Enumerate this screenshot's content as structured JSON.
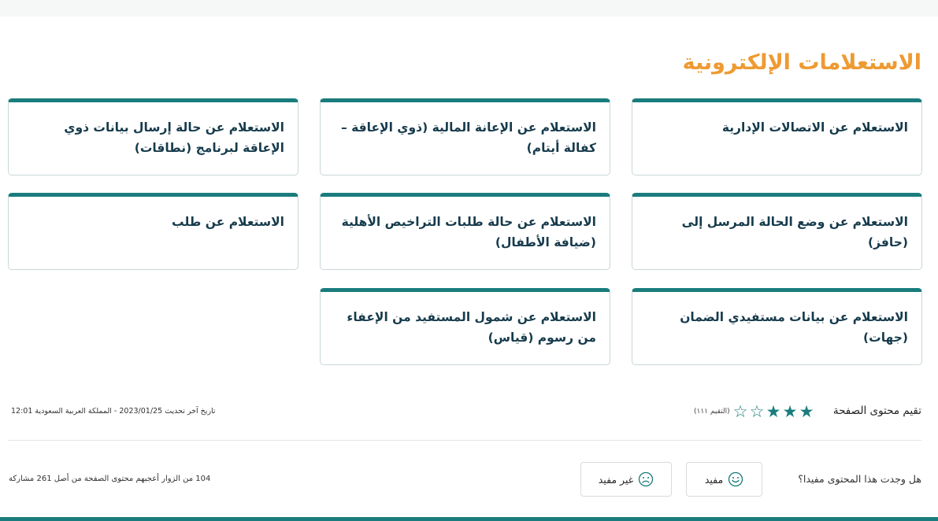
{
  "section": {
    "title": "الاستعلامات الإلكترونية"
  },
  "cards": [
    {
      "label": "الاستعلام عن الاتصالات الإدارية"
    },
    {
      "label": "الاستعلام عن الإعانة المالية (ذوي الإعاقة – كفالة أيتام)"
    },
    {
      "label": "الاستعلام عن حالة إرسال بيانات ذوي الإعاقة لبرنامج (نطاقات)"
    },
    {
      "label": "الاستعلام عن وضع الحالة المرسل إلى (حافز)"
    },
    {
      "label": "الاستعلام عن حالة طلبات التراخيص الأهلية (ضيافة الأطفال)"
    },
    {
      "label": "الاستعلام عن طلب"
    },
    {
      "label": "الاستعلام عن بيانات مستفيدي الضمان (جهات)"
    },
    {
      "label": "الاستعلام عن شمول المستفيد من الإعفاء من رسوم (قياس)"
    }
  ],
  "rating": {
    "label": "تقيم محتوى الصفحة",
    "value": 3,
    "max": 5,
    "count_text": "(التقيم ١١١)",
    "accent": "#1a7c7d"
  },
  "last_updated": "تاريخ آخر تحديث 2023/01/25 - المملكة العربية السعودية 12:01",
  "feedback": {
    "question": "هل وجدت هذا المحتوى مفيدا؟",
    "yes_label": "مفيد",
    "no_label": "غير مفيد",
    "yes_icon": "smile-face-icon",
    "no_icon": "frown-face-icon",
    "stats": "104 من الزوار أعجبهم محتوى الصفحة من أصل 261 مشاركة"
  },
  "colors": {
    "title": "#ee9a32",
    "accent": "#1a7c7d",
    "text": "#163b4c"
  }
}
